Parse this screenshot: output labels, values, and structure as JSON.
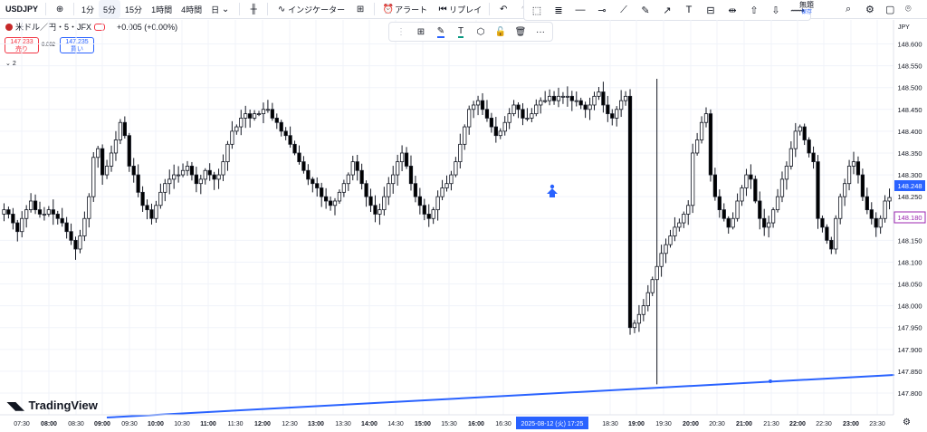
{
  "toolbar": {
    "symbol": "USDJPY",
    "add_icon": "plus-circle-icon",
    "intervals": [
      "1分",
      "5分",
      "15分",
      "1時間",
      "4時間",
      "日"
    ],
    "active_interval": "5分",
    "indicators_label": "インジケーター",
    "alert_label": "アラート",
    "replay_label": "リプレイ",
    "save_label": "無題",
    "save_sub": "保存"
  },
  "legend": {
    "title": "米ドル／円・5・JFX",
    "change": "+0.005 (+0.00%)",
    "sell_price": "147.233",
    "sell_label": "売り",
    "spread": "0.002",
    "buy_price": "147.235",
    "buy_label": "買い",
    "collapse_label": "2"
  },
  "branding": "TradingView",
  "colors": {
    "up": "#131722",
    "down": "#131722",
    "up_fill": "#ffffff",
    "down_fill": "#000000",
    "trendline": "#2962ff",
    "current_price_bg": "#2962ff",
    "bid_label_border": "#9c27b0",
    "grid": "#f0f3fa"
  },
  "chart_data": {
    "type": "candlestick",
    "unit": "JPY",
    "current_price": "148.248",
    "bid_price": "148.180",
    "ylim": [
      147.76,
      148.64
    ],
    "y_ticks": [
      "148.600",
      "148.550",
      "148.500",
      "148.450",
      "148.400",
      "148.350",
      "148.300",
      "148.250",
      "148.200",
      "148.150",
      "148.100",
      "148.050",
      "148.000",
      "147.950",
      "147.900",
      "147.850",
      "147.800"
    ],
    "x_ticks": [
      {
        "label": "07:30",
        "bold": false
      },
      {
        "label": "08:00",
        "bold": true
      },
      {
        "label": "08:30",
        "bold": false
      },
      {
        "label": "09:00",
        "bold": true
      },
      {
        "label": "09:30",
        "bold": false
      },
      {
        "label": "10:00",
        "bold": true
      },
      {
        "label": "10:30",
        "bold": false
      },
      {
        "label": "11:00",
        "bold": true
      },
      {
        "label": "11:30",
        "bold": false
      },
      {
        "label": "12:00",
        "bold": true
      },
      {
        "label": "12:30",
        "bold": false
      },
      {
        "label": "13:00",
        "bold": true
      },
      {
        "label": "13:30",
        "bold": false
      },
      {
        "label": "14:00",
        "bold": true
      },
      {
        "label": "14:30",
        "bold": false
      },
      {
        "label": "15:00",
        "bold": true
      },
      {
        "label": "15:30",
        "bold": false
      },
      {
        "label": "16:00",
        "bold": true
      },
      {
        "label": "16:30",
        "bold": false
      },
      {
        "label": "18:30",
        "bold": false
      },
      {
        "label": "19:00",
        "bold": true
      },
      {
        "label": "19:30",
        "bold": false
      },
      {
        "label": "20:00",
        "bold": true
      },
      {
        "label": "20:30",
        "bold": false
      },
      {
        "label": "21:00",
        "bold": true
      },
      {
        "label": "21:30",
        "bold": false
      },
      {
        "label": "22:00",
        "bold": true
      },
      {
        "label": "22:30",
        "bold": false
      },
      {
        "label": "23:00",
        "bold": true
      },
      {
        "label": "23:30",
        "bold": false
      }
    ],
    "crosshair_time": "2025-08-12 (火)   17:25",
    "closes": [
      148.22,
      148.21,
      148.19,
      148.17,
      148.2,
      148.22,
      148.24,
      148.22,
      148.21,
      148.21,
      148.22,
      148.21,
      148.2,
      148.19,
      148.17,
      148.15,
      148.13,
      148.16,
      148.2,
      148.25,
      148.34,
      148.36,
      148.3,
      148.32,
      148.35,
      148.38,
      148.42,
      148.39,
      148.32,
      148.3,
      148.26,
      148.23,
      148.22,
      148.2,
      148.23,
      148.26,
      148.28,
      148.29,
      148.3,
      148.3,
      148.31,
      148.32,
      148.3,
      148.28,
      148.29,
      148.31,
      148.3,
      148.29,
      148.3,
      148.33,
      148.37,
      148.4,
      148.41,
      148.43,
      148.44,
      148.43,
      148.44,
      148.44,
      148.45,
      148.45,
      148.43,
      148.42,
      148.4,
      148.39,
      148.37,
      148.35,
      148.33,
      148.31,
      148.29,
      148.28,
      148.27,
      148.25,
      148.24,
      148.23,
      148.24,
      148.26,
      148.28,
      148.3,
      148.33,
      148.31,
      148.28,
      148.25,
      148.23,
      148.21,
      148.22,
      148.25,
      148.28,
      148.3,
      148.33,
      148.35,
      148.32,
      148.28,
      148.25,
      148.23,
      148.21,
      148.2,
      148.22,
      148.25,
      148.27,
      148.28,
      148.3,
      148.33,
      148.37,
      148.41,
      148.45,
      148.46,
      148.47,
      148.45,
      148.43,
      148.41,
      148.39,
      148.4,
      148.42,
      148.44,
      148.46,
      148.45,
      148.43,
      148.43,
      148.44,
      148.46,
      148.47,
      148.47,
      148.48,
      148.47,
      148.48,
      148.48,
      148.48,
      148.47,
      148.47,
      148.46,
      148.45,
      148.46,
      148.48,
      148.49,
      148.46,
      148.44,
      148.43,
      148.45,
      148.47,
      148.48,
      147.95,
      147.96,
      147.98,
      148.0,
      148.03,
      148.06,
      148.09,
      148.12,
      148.14,
      148.16,
      148.18,
      148.19,
      148.21,
      148.23,
      148.35,
      148.38,
      148.42,
      148.44,
      148.3,
      148.25,
      148.22,
      148.2,
      148.18,
      148.2,
      148.24,
      148.27,
      148.3,
      148.29,
      148.24,
      148.2,
      148.18,
      148.19,
      148.22,
      148.25,
      148.29,
      148.32,
      148.36,
      148.4,
      148.41,
      148.38,
      148.35,
      148.33,
      148.2,
      148.18,
      148.15,
      148.13,
      148.2,
      148.25,
      148.28,
      148.32,
      148.33,
      148.3,
      148.25,
      148.22,
      148.2,
      148.18,
      148.2,
      148.24,
      148.248
    ]
  }
}
